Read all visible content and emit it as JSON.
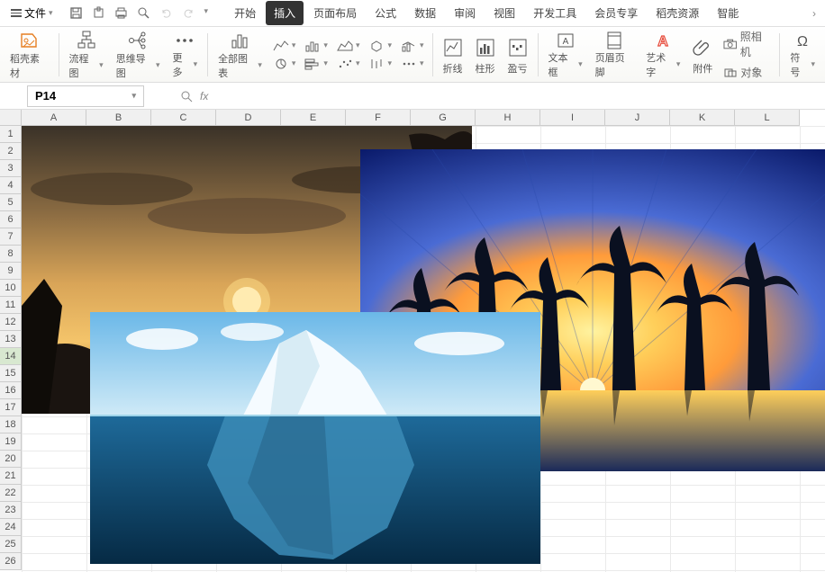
{
  "menu": {
    "file": "文件"
  },
  "tabs": [
    "开始",
    "插入",
    "页面布局",
    "公式",
    "数据",
    "审阅",
    "视图",
    "开发工具",
    "会员专享",
    "稻壳资源",
    "智能"
  ],
  "activeTab": 1,
  "ribbon": {
    "docerMaterial": "稻壳素材",
    "flowChart": "流程图",
    "mindMap": "思维导图",
    "more": "更多",
    "allCharts": "全部图表",
    "sparkLine": "折线",
    "sparkBar": "柱形",
    "sparkWinLoss": "盈亏",
    "textBox": "文本框",
    "headerFooter": "页眉页脚",
    "wordArt": "艺术字",
    "attachment": "附件",
    "camera": "照相机",
    "object": "对象",
    "symbol": "符号"
  },
  "namebox": "P14",
  "columns": [
    "A",
    "B",
    "C",
    "D",
    "E",
    "F",
    "G",
    "H",
    "I",
    "J",
    "K",
    "L"
  ],
  "rows": [
    "1",
    "2",
    "3",
    "4",
    "5",
    "6",
    "7",
    "8",
    "9",
    "10",
    "11",
    "12",
    "13",
    "14",
    "15",
    "16",
    "17",
    "18",
    "19",
    "20",
    "21",
    "22",
    "23",
    "24",
    "25",
    "26"
  ],
  "selectedRow": 14,
  "images": {
    "sunset": "sunset-landscape",
    "palm": "tropical-palms-sunset",
    "iceberg": "iceberg-ocean"
  }
}
